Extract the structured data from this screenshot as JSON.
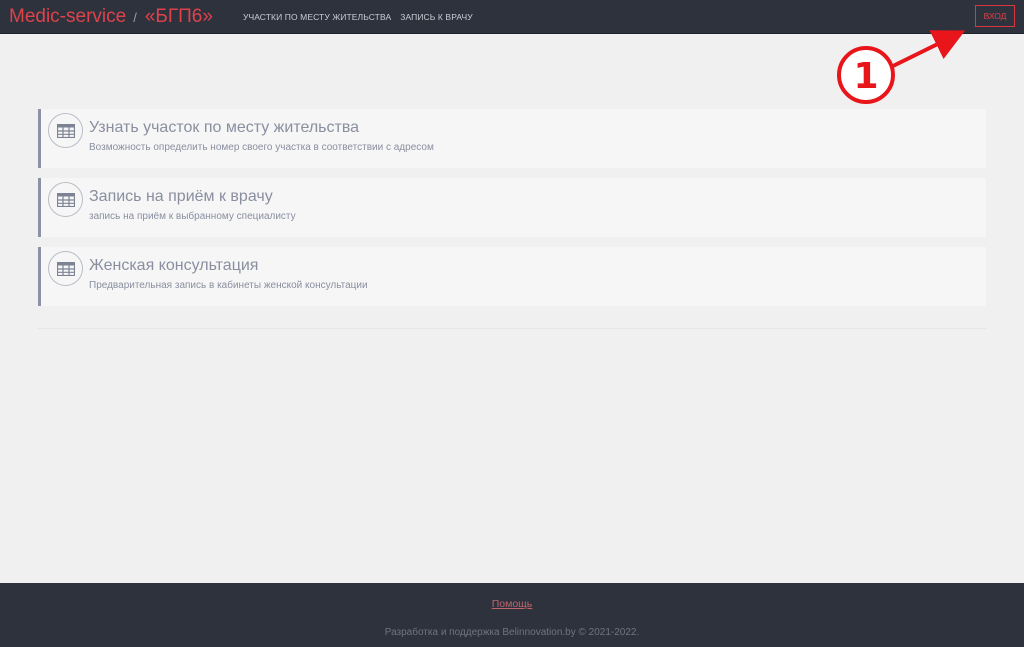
{
  "header": {
    "brand_name": "Medic-service",
    "separator": "/",
    "org_name": "«БГП6»",
    "nav": [
      {
        "label": "участки по месту жительства"
      },
      {
        "label": "запись к врачу"
      }
    ],
    "login_label": "вход"
  },
  "annotation": {
    "number": "1",
    "color": "#e8151b"
  },
  "services": [
    {
      "title": "Узнать участок по месту жительства",
      "description": "Возможность определить номер своего участка в соответствии с адресом",
      "icon": "table-icon"
    },
    {
      "title": "Запись на приём к врачу",
      "description": "запись на приём к выбранному специалисту",
      "icon": "table-icon"
    },
    {
      "title": "Женская консультация",
      "description": "Предварительная запись в кабинеты женской консультации",
      "icon": "table-icon"
    }
  ],
  "footer": {
    "help_label": "Помощь",
    "copyright": "Разработка и поддержка Belinnovation.by © 2021-2022."
  },
  "colors": {
    "accent": "#e0424a",
    "nav_bg": "#2e323d",
    "page_bg": "#f0f0f0",
    "card_border": "#8c92a3"
  }
}
